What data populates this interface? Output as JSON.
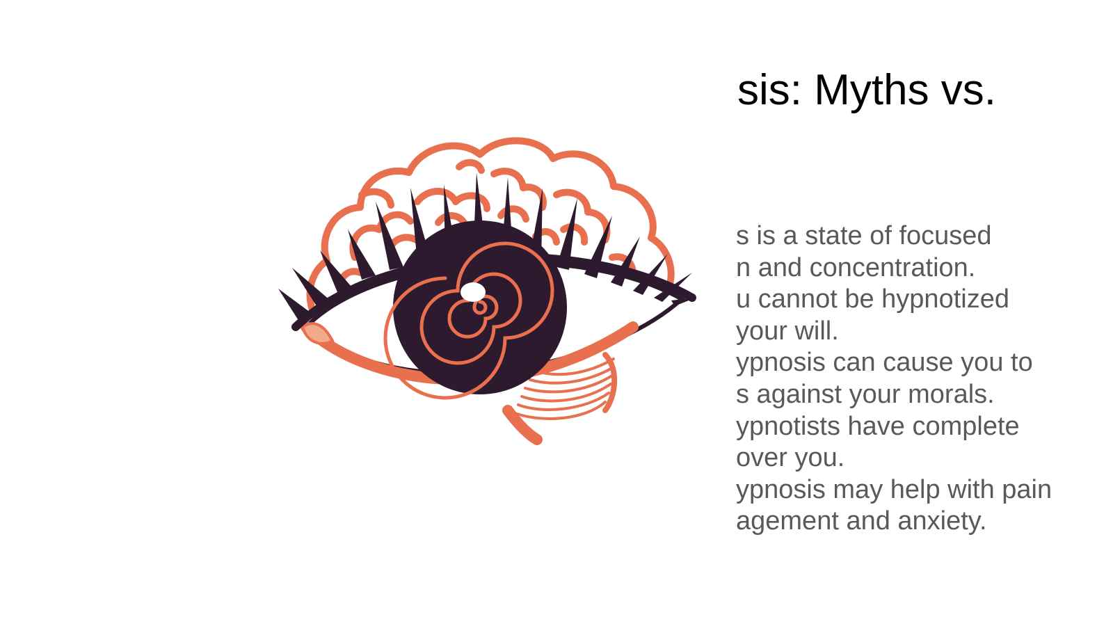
{
  "slide": {
    "title": "sis: Myths vs.",
    "body_lines": [
      "s is a state of focused",
      "n and concentration.",
      "u cannot be hypnotized",
      "your will.",
      "ypnosis can cause you to",
      "s against your morals.",
      "ypnotists have complete",
      "over you.",
      "ypnosis may help with pain",
      "agement and anxiety."
    ]
  },
  "illustration": {
    "icon": "brain-eye-spiral-icon",
    "colors": {
      "brain_outline": "#E8704F",
      "iris": "#2E1A2E",
      "spiral": "#E8704F",
      "lashes": "#2E1A2E",
      "highlight": "#FFFFFF",
      "eye_corner": "#F4A98A"
    }
  }
}
